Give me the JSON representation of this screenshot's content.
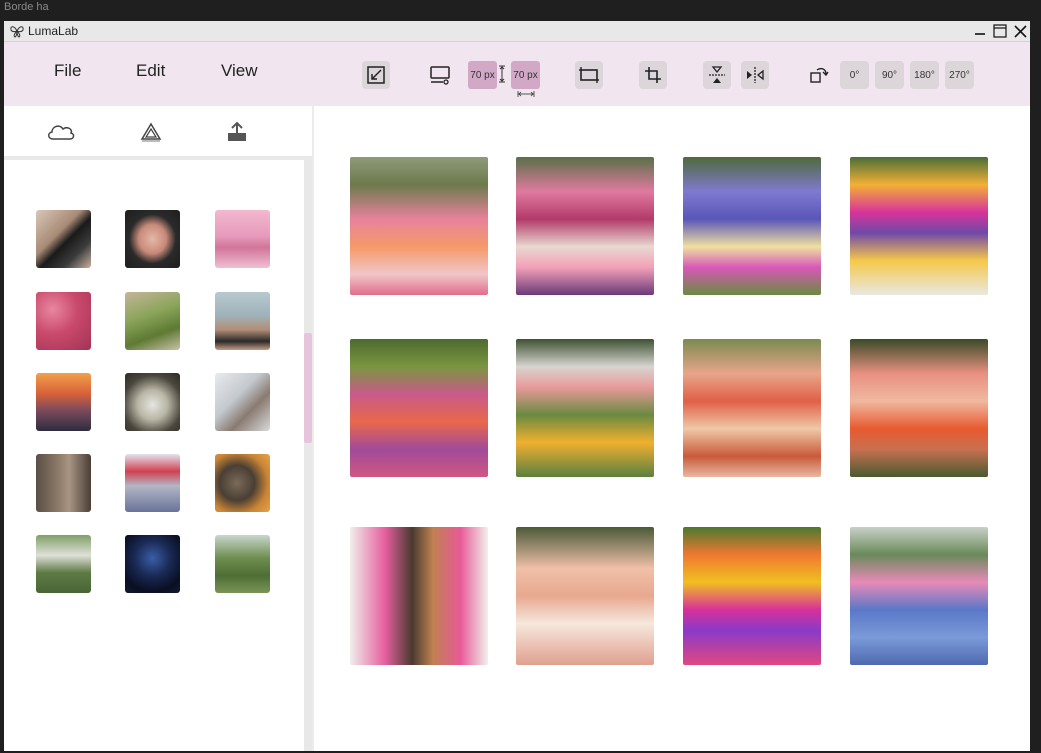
{
  "outer_window_label": "Borde ha",
  "app": {
    "title": "LumaLab"
  },
  "window_controls": {
    "minimize": "minimize-icon",
    "maximize": "maximize-icon",
    "close": "close-icon"
  },
  "menu": {
    "file": "File",
    "edit": "Edit",
    "view": "View"
  },
  "toolbar": {
    "icons": [
      "resize-icon",
      "display-icon",
      "aspect-ratio-icon",
      "crop-icon",
      "flip-vertical-icon",
      "flip-horizontal-icon",
      "rotate-icon"
    ],
    "width_value": "70 px",
    "height_value": "70 px",
    "rotations": [
      "0°",
      "90°",
      "180°",
      "270°"
    ]
  },
  "sidebar": {
    "tabs": [
      "cloud-icon",
      "drive-icon",
      "upload-icon"
    ],
    "thumbnails": [
      "camera lens",
      "airplane window",
      "cherry blossom train",
      "raspberries",
      "hand mirror landscape",
      "camera by sea",
      "sunset mountains",
      "chess piece mirror",
      "woman in car",
      "old alley",
      "red hat woman",
      "coin and drink",
      "woman with dog",
      "couple at night",
      "woman in field"
    ]
  },
  "gallery": {
    "photos": [
      "dahlia garden",
      "foxglove and daisies",
      "lupine garden",
      "butterfly garden",
      "garden path flowers",
      "greenhouse garden",
      "tulip bed",
      "cosmos garden",
      "cats in flower window",
      "ranunculus field",
      "sunflower zinnia garden",
      "hydrangea garden"
    ]
  },
  "colors": {
    "menubar": "#f1e6ef",
    "accent": "#d1a9c7",
    "scroll_thumb": "#e6c4dc"
  }
}
